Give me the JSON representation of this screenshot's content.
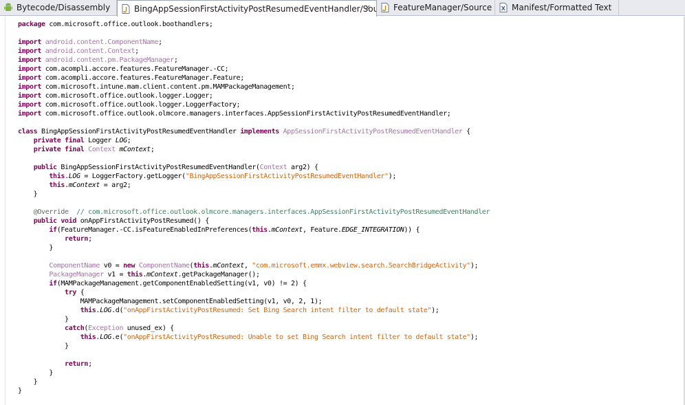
{
  "tabs": [
    {
      "label": "Bytecode/Disassembly",
      "icon": "android-icon",
      "active": false
    },
    {
      "label": "BingAppSessionFirstActivityPostResumedEventHandler/Source",
      "icon": "java-file-icon",
      "active": true,
      "close": "✕"
    },
    {
      "label": "FeatureManager/Source",
      "icon": "java-file-icon",
      "active": false
    },
    {
      "label": "Manifest/Formatted Text",
      "icon": "xml-file-icon",
      "active": false
    }
  ],
  "code_lines": [
    [
      [
        "kw",
        "package"
      ],
      [
        "",
        "com.microsoft.office.outlook.boothandlers;"
      ]
    ],
    [],
    [
      [
        "kw",
        "import"
      ],
      [
        "",
        ""
      ],
      [
        "ty",
        "android.content.ComponentName"
      ],
      [
        "",
        ";"
      ]
    ],
    [
      [
        "kw",
        "import"
      ],
      [
        "",
        ""
      ],
      [
        "ty",
        "android.content.Context"
      ],
      [
        "",
        ";"
      ]
    ],
    [
      [
        "kw",
        "import"
      ],
      [
        "",
        ""
      ],
      [
        "ty",
        "android.content.pm.PackageManager"
      ],
      [
        "",
        ";"
      ]
    ],
    [
      [
        "kw",
        "import"
      ],
      [
        "",
        "com.acompli.accore.features.FeatureManager.-CC;"
      ]
    ],
    [
      [
        "kw",
        "import"
      ],
      [
        "",
        "com.acompli.accore.features.FeatureManager.Feature;"
      ]
    ],
    [
      [
        "kw",
        "import"
      ],
      [
        "",
        "com.microsoft.intune.mam.client.content.pm.MAMPackageManagement;"
      ]
    ],
    [
      [
        "kw",
        "import"
      ],
      [
        "",
        "com.microsoft.office.outlook.logger.Logger;"
      ]
    ],
    [
      [
        "kw",
        "import"
      ],
      [
        "",
        "com.microsoft.office.outlook.logger.LoggerFactory;"
      ]
    ],
    [
      [
        "kw",
        "import"
      ],
      [
        "",
        "com.microsoft.office.outlook.olmcore.managers.interfaces.AppSessionFirstActivityPostResumedEventHandler;"
      ]
    ],
    [],
    [
      [
        "kw",
        "class"
      ],
      [
        "",
        "BingAppSessionFirstActivityPostResumedEventHandler "
      ],
      [
        "kw",
        "implements"
      ],
      [
        "",
        ""
      ],
      [
        "ty",
        "AppSessionFirstActivityPostResumedEventHandler"
      ],
      [
        "",
        ""
      ],
      [
        "",
        ""
      ],
      [
        "",
        "{"
      ]
    ],
    [
      [
        "",
        "    "
      ],
      [
        "kw",
        "private final"
      ],
      [
        "",
        "Logger "
      ],
      [
        "it",
        "LOG"
      ],
      [
        "",
        ";"
      ]
    ],
    [
      [
        "",
        "    "
      ],
      [
        "kw",
        "private final"
      ],
      [
        "",
        ""
      ],
      [
        "ty",
        "Context"
      ],
      [
        "",
        ""
      ],
      [
        "it",
        "mContext"
      ],
      [
        "",
        ";"
      ]
    ],
    [],
    [
      [
        "",
        "    "
      ],
      [
        "kw",
        "public"
      ],
      [
        "",
        "BingAppSessionFirstActivityPostResumedEventHandler("
      ],
      [
        "ty",
        "Context"
      ],
      [
        "",
        "arg2) {"
      ]
    ],
    [
      [
        "",
        "        "
      ],
      [
        "kw",
        "this"
      ],
      [
        "",
        "."
      ],
      [
        "it",
        "LOG"
      ],
      [
        "",
        ""
      ],
      [
        "",
        "= LoggerFactory.getLogger("
      ],
      [
        "str",
        "\"BingAppSessionFirstActivityPostResumedEventHandler\""
      ],
      [
        "",
        ");"
      ]
    ],
    [
      [
        "",
        "        "
      ],
      [
        "kw",
        "this"
      ],
      [
        "",
        "."
      ],
      [
        "it",
        "mContext"
      ],
      [
        "",
        ""
      ],
      [
        "",
        "= arg2;"
      ]
    ],
    [
      [
        "",
        "    }"
      ]
    ],
    [],
    [
      [
        "",
        "    "
      ],
      [
        "ann",
        "@Override"
      ],
      [
        "",
        "  "
      ],
      [
        "cm",
        "// com.microsoft.office.outlook.olmcore.managers.interfaces.AppSessionFirstActivityPostResumedEventHandler"
      ]
    ],
    [
      [
        "",
        "    "
      ],
      [
        "kw",
        "public void"
      ],
      [
        "",
        "onAppFirstActivityPostResumed() {"
      ]
    ],
    [
      [
        "",
        "        "
      ],
      [
        "kw",
        "if"
      ],
      [
        "",
        "(FeatureManager.-CC.isFeatureEnabledInPreferences("
      ],
      [
        "kw",
        "this"
      ],
      [
        "",
        "."
      ],
      [
        "it",
        "mContext"
      ],
      [
        "",
        ", Feature."
      ],
      [
        "it",
        "EDGE_INTEGRATION"
      ],
      [
        "",
        ")) {"
      ]
    ],
    [
      [
        "",
        "            "
      ],
      [
        "kw",
        "return"
      ],
      [
        "",
        ";"
      ]
    ],
    [
      [
        "",
        "        }"
      ]
    ],
    [],
    [
      [
        "",
        "        "
      ],
      [
        "ty",
        "ComponentName"
      ],
      [
        "",
        "v0 = "
      ],
      [
        "kw",
        "new"
      ],
      [
        "",
        ""
      ],
      [
        "ty",
        "ComponentName"
      ],
      [
        "",
        "("
      ],
      [
        "kw",
        "this"
      ],
      [
        "",
        "."
      ],
      [
        "it",
        "mContext"
      ],
      [
        "",
        ", "
      ],
      [
        "str",
        "\"com.microsoft.emmx.webview.search.SearchBridgeActivity\""
      ],
      [
        "",
        ");"
      ]
    ],
    [
      [
        "",
        "        "
      ],
      [
        "ty",
        "PackageManager"
      ],
      [
        "",
        "v1 = "
      ],
      [
        "kw",
        "this"
      ],
      [
        "",
        "."
      ],
      [
        "it",
        "mContext"
      ],
      [
        "",
        ".getPackageManager();"
      ]
    ],
    [
      [
        "",
        "        "
      ],
      [
        "kw",
        "if"
      ],
      [
        "",
        "(MAMPackageManagement.getComponentEnabledSetting(v1, v0) != 2) {"
      ]
    ],
    [
      [
        "",
        "            "
      ],
      [
        "kw",
        "try"
      ],
      [
        "",
        "{"
      ]
    ],
    [
      [
        "",
        "                MAMPackageManagement.setComponentEnabledSetting(v1, v0, 2, 1);"
      ]
    ],
    [
      [
        "",
        "                "
      ],
      [
        "kw",
        "this"
      ],
      [
        "",
        "."
      ],
      [
        "it",
        "LOG"
      ],
      [
        "",
        ".d("
      ],
      [
        "str",
        "\"onAppFirstActivityPostResumed: Set Bing Search intent filter to default state\""
      ],
      [
        "",
        ");"
      ]
    ],
    [
      [
        "",
        "            }"
      ]
    ],
    [
      [
        "",
        "            "
      ],
      [
        "kw",
        "catch"
      ],
      [
        "",
        "("
      ],
      [
        "ty",
        "Exception"
      ],
      [
        "",
        "unused_ex) {"
      ]
    ],
    [
      [
        "",
        "                "
      ],
      [
        "kw",
        "this"
      ],
      [
        "",
        "."
      ],
      [
        "it",
        "LOG"
      ],
      [
        "",
        ".e("
      ],
      [
        "str",
        "\"onAppFirstActivityPostResumed: Unable to set Bing Search intent filter to default state\""
      ],
      [
        "",
        ");"
      ]
    ],
    [
      [
        "",
        "            }"
      ]
    ],
    [],
    [
      [
        "",
        "            "
      ],
      [
        "kw",
        "return"
      ],
      [
        "",
        ";"
      ]
    ],
    [
      [
        "",
        "        }"
      ]
    ],
    [
      [
        "",
        "    }"
      ]
    ],
    [
      [
        "",
        "}"
      ]
    ]
  ]
}
